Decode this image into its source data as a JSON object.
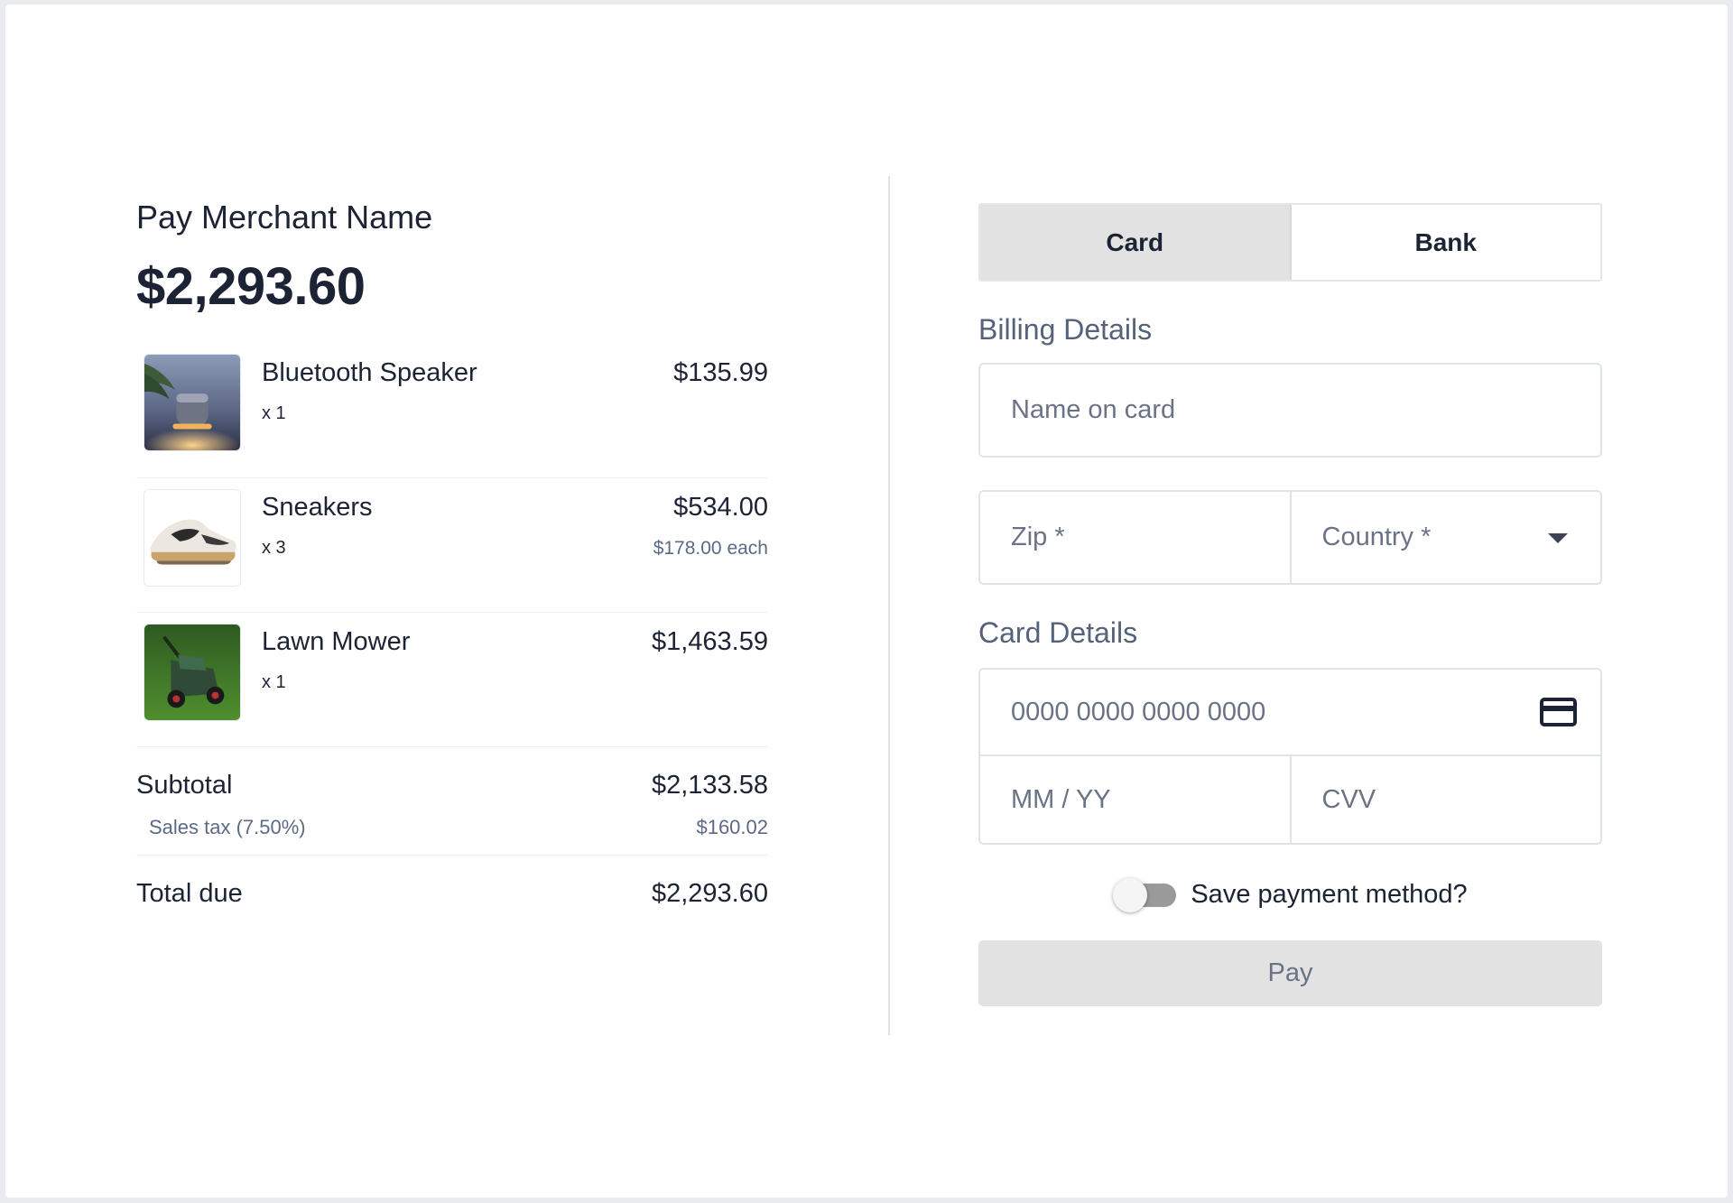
{
  "summary": {
    "merchant_label": "Pay Merchant Name",
    "amount": "$2,293.60",
    "items": [
      {
        "name": "Bluetooth Speaker",
        "qty": "x 1",
        "price": "$135.99",
        "each": "",
        "image": "bluetooth-speaker-image"
      },
      {
        "name": "Sneakers",
        "qty": "x 3",
        "price": "$534.00",
        "each": "$178.00 each",
        "image": "sneakers-image"
      },
      {
        "name": "Lawn Mower",
        "qty": "x 1",
        "price": "$1,463.59",
        "each": "",
        "image": "lawn-mower-image"
      }
    ],
    "subtotal_label": "Subtotal",
    "subtotal_value": "$2,133.58",
    "tax_label": "Sales tax (7.50%)",
    "tax_value": "$160.02",
    "total_label": "Total due",
    "total_value": "$2,293.60"
  },
  "payment": {
    "tabs": [
      {
        "label": "Card",
        "active": true
      },
      {
        "label": "Bank",
        "active": false
      }
    ],
    "billing_title": "Billing Details",
    "name_placeholder": "Name on card",
    "zip_placeholder": "Zip *",
    "country_placeholder": "Country *",
    "card_title": "Card Details",
    "card_number_placeholder": "0000 0000 0000 0000",
    "expiry_placeholder": "MM / YY",
    "cvv_placeholder": "CVV",
    "save_label": "Save payment method?",
    "save_enabled": false,
    "pay_label": "Pay"
  },
  "colors": {
    "text": "#1c2334",
    "muted": "#5c6a85",
    "tab_active_bg": "#e2e2e3",
    "pay_button_bg": "#e2e2e3",
    "toggle_track": "#9a9a9a"
  },
  "icons": [
    "credit-card-icon",
    "chevron-down-icon"
  ]
}
